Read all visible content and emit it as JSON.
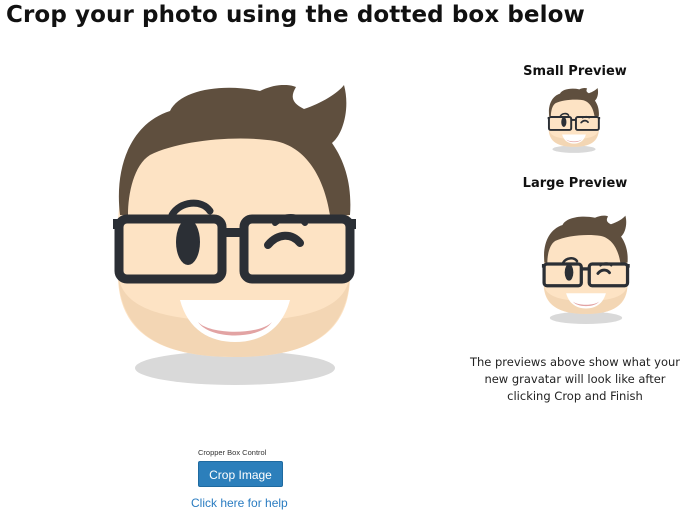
{
  "header": {
    "title": "Crop your photo using the dotted box below"
  },
  "preview": {
    "small_title": "Small Preview",
    "large_title": "Large Preview",
    "note": "The previews above show what your new gravatar will look like after clicking Crop and Finish"
  },
  "cropper": {
    "label": "Cropper Box Control",
    "button_label": "Crop Image",
    "help_link": "Click here for help"
  },
  "colors": {
    "button_bg": "#2c7fbb",
    "link": "#2a7cc1",
    "hair": "#5f4f3e",
    "skin": "#fde3c4",
    "skin_shade": "#f3d6b4",
    "glasses": "#2b2f35",
    "shadow": "#d6d6d6",
    "tongue": "#e2a3a3"
  },
  "icons": {
    "avatar": "cartoon-face-with-glasses-avatar"
  }
}
